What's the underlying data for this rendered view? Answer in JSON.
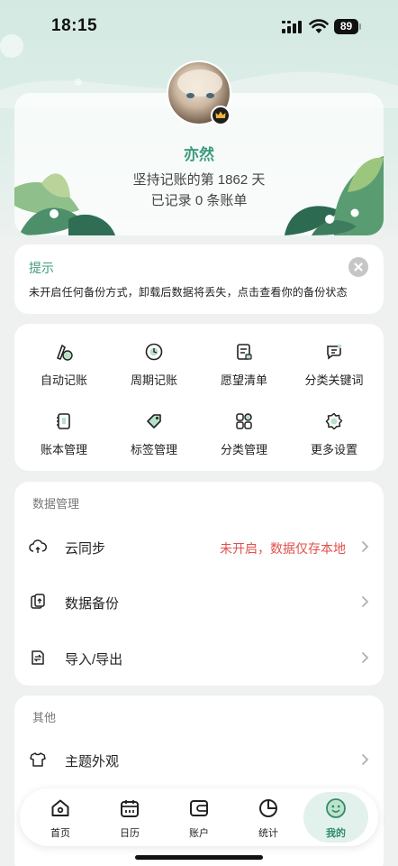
{
  "status_bar": {
    "time": "18:15",
    "battery": "89"
  },
  "profile": {
    "name": "亦然",
    "streak_text": "坚持记账的第 1862 天",
    "records_text": "已记录 0 条账单"
  },
  "tip": {
    "title": "提示",
    "message": "未开启任何备份方式，卸载后数据将丢失，点击查看你的备份状态"
  },
  "grid": {
    "items": [
      {
        "label": "自动记账",
        "icon": "auto-bookkeeping-icon"
      },
      {
        "label": "周期记账",
        "icon": "periodic-bookkeeping-icon"
      },
      {
        "label": "愿望清单",
        "icon": "wishlist-icon"
      },
      {
        "label": "分类关键词",
        "icon": "category-keyword-icon"
      },
      {
        "label": "账本管理",
        "icon": "ledger-icon"
      },
      {
        "label": "标签管理",
        "icon": "tag-icon"
      },
      {
        "label": "分类管理",
        "icon": "category-icon"
      },
      {
        "label": "更多设置",
        "icon": "gear-icon"
      }
    ]
  },
  "data_section": {
    "title": "数据管理",
    "rows": [
      {
        "label": "云同步",
        "status": "未开启，数据仅存本地",
        "icon": "cloud-sync-icon"
      },
      {
        "label": "数据备份",
        "status": "",
        "icon": "backup-icon"
      },
      {
        "label": "导入/导出",
        "status": "",
        "icon": "import-export-icon"
      }
    ]
  },
  "other_section": {
    "title": "其他",
    "rows": [
      {
        "label": "主题外观",
        "icon": "tshirt-icon"
      }
    ]
  },
  "nav": {
    "items": [
      {
        "label": "首页",
        "icon": "home-icon"
      },
      {
        "label": "日历",
        "icon": "calendar-icon"
      },
      {
        "label": "账户",
        "icon": "wallet-icon"
      },
      {
        "label": "统计",
        "icon": "pie-chart-icon"
      },
      {
        "label": "我的",
        "icon": "smiley-icon",
        "active": true
      }
    ]
  },
  "colors": {
    "accent": "#3f9a7f",
    "warning": "#e0504f",
    "background": "#eef1f0"
  }
}
